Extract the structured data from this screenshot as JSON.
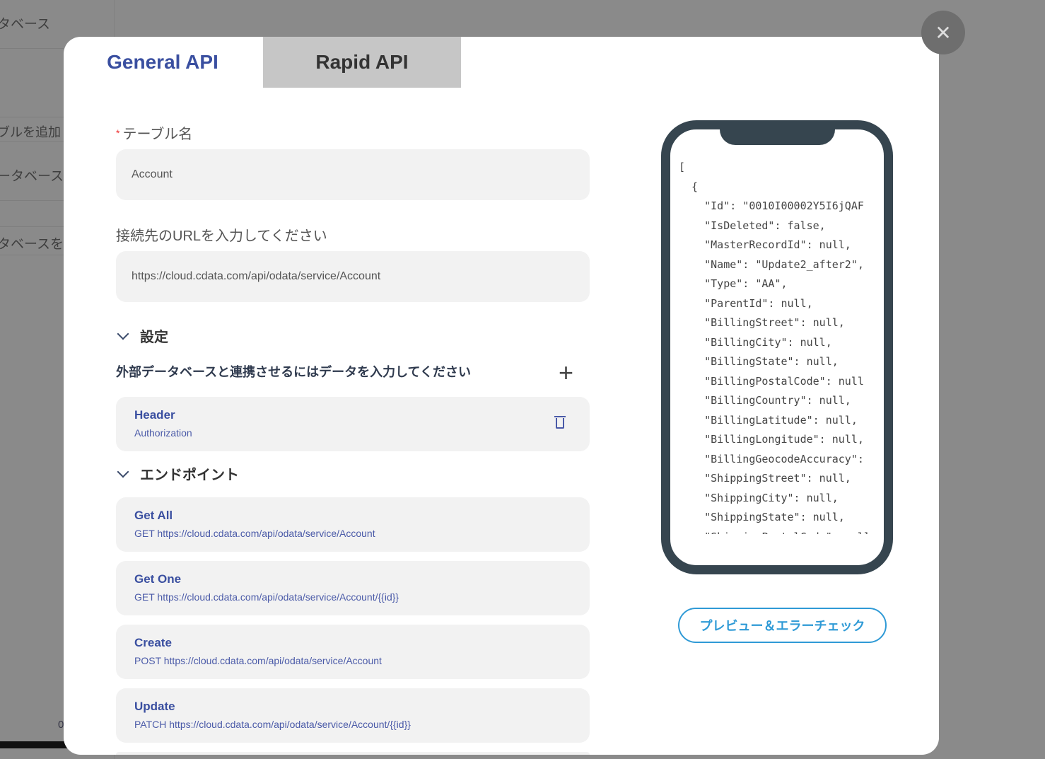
{
  "background": {
    "items": [
      "タベース",
      "ブルを追加",
      "ータベース",
      "タベースを追"
    ],
    "footer_char": "0"
  },
  "tabs": {
    "general": "General API",
    "rapid": "Rapid API"
  },
  "close_icon": "close-icon",
  "form": {
    "table_name_label": "テーブル名",
    "required_mark": "*",
    "table_name_value": "Account",
    "url_label": "接続先のURLを入力してください",
    "url_value": "https://cloud.cdata.com/api/odata/service/Account",
    "settings_title": "設定",
    "settings_hint": "外部データベースと連携させるにはデータを入力してください",
    "header_card": {
      "title": "Header",
      "subtitle": "Authorization"
    },
    "endpoints_title": "エンドポイント",
    "endpoints": [
      {
        "title": "Get All",
        "subtitle": "GET https://cloud.cdata.com/api/odata/service/Account"
      },
      {
        "title": "Get One",
        "subtitle": "GET https://cloud.cdata.com/api/odata/service/Account/{{id}}"
      },
      {
        "title": "Create",
        "subtitle": "POST https://cloud.cdata.com/api/odata/service/Account"
      },
      {
        "title": "Update",
        "subtitle": "PATCH https://cloud.cdata.com/api/odata/service/Account/{{id}}"
      }
    ]
  },
  "preview": {
    "json": "[\n  {\n    \"Id\": \"0010I00002Y5I6jQAF\n    \"IsDeleted\": false,\n    \"MasterRecordId\": null,\n    \"Name\": \"Update2_after2\",\n    \"Type\": \"AA\",\n    \"ParentId\": null,\n    \"BillingStreet\": null,\n    \"BillingCity\": null,\n    \"BillingState\": null,\n    \"BillingPostalCode\": null\n    \"BillingCountry\": null,\n    \"BillingLatitude\": null,\n    \"BillingLongitude\": null,\n    \"BillingGeocodeAccuracy\":\n    \"ShippingStreet\": null,\n    \"ShippingCity\": null,\n    \"ShippingState\": null,\n    \"ShippingPostalCode\": null",
    "button": "プレビュー＆エラーチェック"
  },
  "colors": {
    "accent": "#3a4fa0",
    "preview": "#2f9ad6",
    "phone": "#36454f"
  }
}
